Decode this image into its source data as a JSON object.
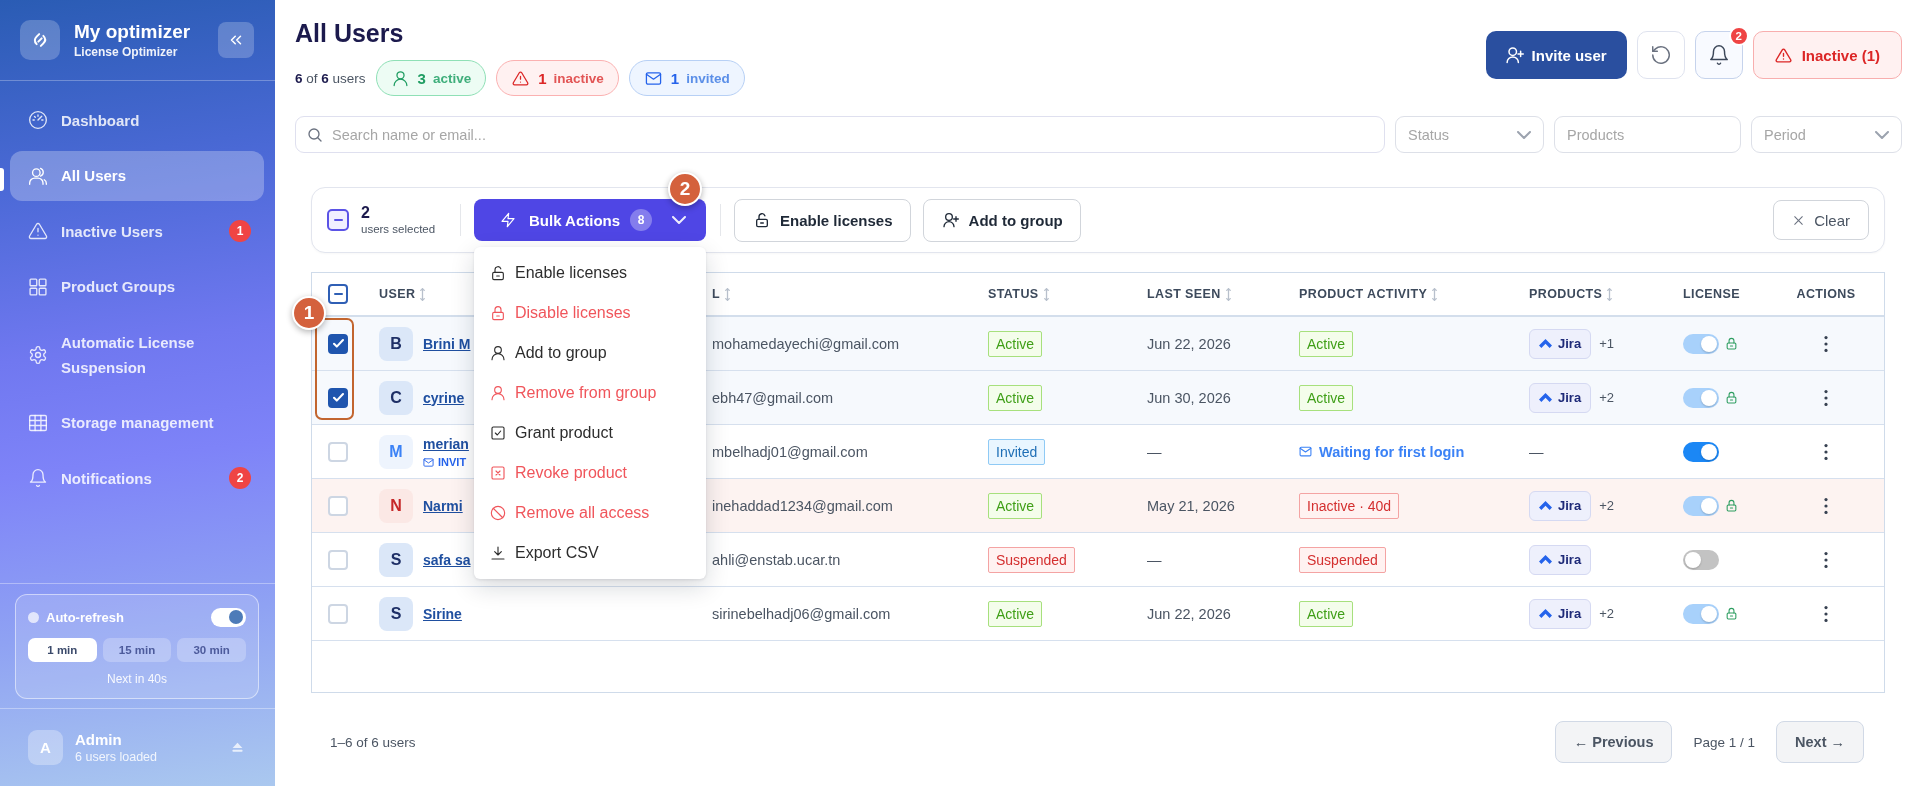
{
  "sidebar": {
    "brand": {
      "name": "My optimizer",
      "subtitle": "License Optimizer"
    },
    "items": [
      {
        "label": "Dashboard",
        "selected": false
      },
      {
        "label": "All Users",
        "selected": true
      },
      {
        "label": "Inactive Users",
        "selected": false,
        "badge": "1"
      },
      {
        "label": "Product Groups",
        "selected": false
      },
      {
        "label": "Automatic License Suspension",
        "selected": false
      },
      {
        "label": "Storage management",
        "selected": false
      },
      {
        "label": "Notifications",
        "selected": false,
        "badge": "2"
      }
    ],
    "auto_refresh": {
      "label": "Auto-refresh",
      "on": true,
      "intervals": [
        {
          "label": "1 min",
          "selected": true
        },
        {
          "label": "15 min",
          "selected": false
        },
        {
          "label": "30 min",
          "selected": false
        }
      ],
      "next": "Next in 40s"
    },
    "account": {
      "initial": "A",
      "name": "Admin",
      "status": "6 users loaded"
    }
  },
  "header": {
    "title": "All Users",
    "summary": "**6** of **6** users",
    "chips": [
      {
        "kind": "active",
        "count": "3",
        "label": "active"
      },
      {
        "kind": "inactive",
        "count": "1",
        "label": "inactive"
      },
      {
        "kind": "invited",
        "count": "1",
        "label": "invited"
      }
    ],
    "actions": [
      {
        "kind": "invite",
        "label": "Invite user"
      },
      {
        "kind": "refresh"
      },
      {
        "kind": "notifications",
        "badge": "2"
      },
      {
        "kind": "inactive",
        "label": "Inactive (1)"
      }
    ]
  },
  "filters": {
    "search": {
      "placeholder": "Search name or email..."
    },
    "fields": [
      {
        "kind": "select",
        "placeholder": "Status"
      },
      {
        "kind": "text",
        "placeholder": "Products"
      },
      {
        "kind": "select",
        "placeholder": "Period"
      }
    ]
  },
  "bulk_bar": {
    "select_all": {
      "partial": true
    },
    "count": "2",
    "count_label": "users selected",
    "bulk_actions": {
      "label": "Bulk Actions",
      "count": "8",
      "expanded": true,
      "callout": "2",
      "menu": [
        {
          "label": "Enable licenses",
          "danger": false
        },
        {
          "label": "Disable licenses",
          "danger": true
        },
        {
          "label": "Add to group",
          "danger": false
        },
        {
          "label": "Remove from group",
          "danger": true
        },
        {
          "label": "Grant product",
          "danger": false
        },
        {
          "label": "Revoke product",
          "danger": true
        },
        {
          "label": "Remove all access",
          "danger": true
        },
        {
          "label": "Export CSV",
          "danger": false
        }
      ]
    },
    "buttons": [
      {
        "label": "Enable licenses"
      },
      {
        "label": "Add to group"
      }
    ],
    "clear": "Clear"
  },
  "table": {
    "select_all": {
      "partial": true
    },
    "callout": "1",
    "columns": [
      {
        "label": "USER",
        "sortable": true
      },
      {
        "label": "L",
        "sortable": true
      },
      {
        "label": "STATUS",
        "sortable": true
      },
      {
        "label": "LAST SEEN",
        "sortable": true
      },
      {
        "label": "PRODUCT ACTIVITY",
        "sortable": true
      },
      {
        "label": "PRODUCTS",
        "sortable": true
      },
      {
        "label": "LICENSE",
        "sortable": false
      },
      {
        "label": "ACTIONS",
        "sortable": false
      }
    ],
    "rows": [
      {
        "selected": true,
        "flagged": false,
        "avatar": {
          "initial": "B",
          "kind": "default"
        },
        "name": "Brini M",
        "email": "mohamedayechi@gmail.com",
        "status": {
          "kind": "active",
          "label": "Active"
        },
        "last_seen": "Jun 22, 2026",
        "activity": {
          "kind": "active",
          "label": "Active"
        },
        "products": {
          "kind": "product",
          "name": "Jira",
          "more": "+1"
        },
        "license": {
          "on": true,
          "locked": true
        }
      },
      {
        "selected": true,
        "flagged": false,
        "avatar": {
          "initial": "C",
          "kind": "default"
        },
        "name": "cyrine",
        "email": "ebh47@gmail.com",
        "status": {
          "kind": "active",
          "label": "Active"
        },
        "last_seen": "Jun 30, 2026",
        "activity": {
          "kind": "active",
          "label": "Active"
        },
        "products": {
          "kind": "product",
          "name": "Jira",
          "more": "+2"
        },
        "license": {
          "on": true,
          "locked": true
        }
      },
      {
        "selected": false,
        "flagged": false,
        "avatar": {
          "initial": "M",
          "kind": "pending"
        },
        "name": "merian",
        "note": "INVIT",
        "email": "mbelhadj01@gmail.com",
        "status": {
          "kind": "invited",
          "label": "Invited"
        },
        "last_seen": "—",
        "activity": {
          "kind": "waiting",
          "label": "Waiting for first login"
        },
        "products": {
          "kind": "none",
          "label": "—"
        },
        "license": {
          "on": true,
          "locked": false
        }
      },
      {
        "selected": false,
        "flagged": true,
        "avatar": {
          "initial": "N",
          "kind": "alert"
        },
        "name": "Narmi",
        "email": "inehaddad1234@gmail.com",
        "status": {
          "kind": "active",
          "label": "Active"
        },
        "last_seen": "May 21, 2026",
        "activity": {
          "kind": "inactive",
          "label": "Inactive · 40d"
        },
        "products": {
          "kind": "product",
          "name": "Jira",
          "more": "+2"
        },
        "license": {
          "on": true,
          "locked": true
        }
      },
      {
        "selected": false,
        "flagged": false,
        "avatar": {
          "initial": "S",
          "kind": "default"
        },
        "name": "safa sa",
        "email": "ahli@enstab.ucar.tn",
        "status": {
          "kind": "suspended",
          "label": "Suspended"
        },
        "last_seen": "—",
        "activity": {
          "kind": "suspended",
          "label": "Suspended"
        },
        "products": {
          "kind": "product",
          "name": "Jira"
        },
        "license": {
          "on": false,
          "locked": false
        }
      },
      {
        "selected": false,
        "flagged": false,
        "avatar": {
          "initial": "S",
          "kind": "default"
        },
        "name": "Sirine",
        "email": "sirinebelhadj06@gmail.com",
        "status": {
          "kind": "active",
          "label": "Active"
        },
        "last_seen": "Jun 22, 2026",
        "activity": {
          "kind": "active",
          "label": "Active"
        },
        "products": {
          "kind": "product",
          "name": "Jira",
          "more": "+2"
        },
        "license": {
          "on": true,
          "locked": true
        }
      }
    ]
  },
  "pagination": {
    "summary": "1–6 of 6 users",
    "previous": "← Previous",
    "page": "Page 1 / 1",
    "next": "Next →"
  }
}
